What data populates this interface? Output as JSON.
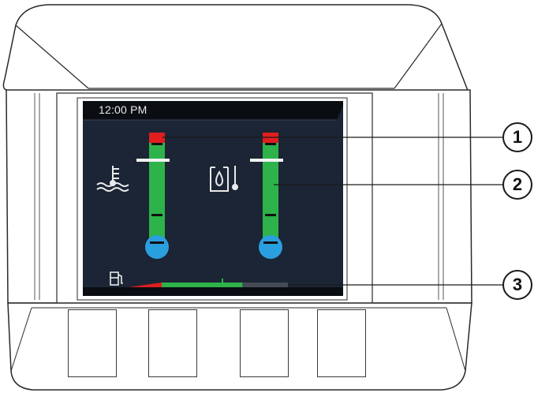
{
  "status_bar": {
    "time": "12:00 PM"
  },
  "gauges": {
    "coolant_temperature": {
      "icon": "coolant-temperature-icon",
      "level": 0.8
    },
    "hydraulic_oil_temperature": {
      "icon": "hydraulic-oil-temperature-icon",
      "level": 0.8
    }
  },
  "fuel": {
    "icon": "fuel-pump-icon",
    "level": 0.64
  },
  "callouts": [
    "1",
    "2",
    "3"
  ],
  "colors": {
    "screen_bg": "#1b2535",
    "gauge_green": "#2db34a",
    "warning_red": "#e01e1e",
    "bulb_blue": "#2a9fe0",
    "ink": "#1a1a1a"
  }
}
